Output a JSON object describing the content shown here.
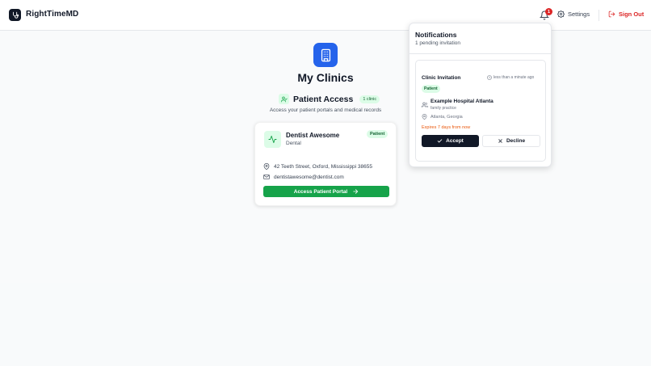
{
  "header": {
    "app_name": "RightTimeMD",
    "notification_count": "1",
    "settings_label": "Settings",
    "signout_label": "Sign Out"
  },
  "main": {
    "title": "My Clinics",
    "section": {
      "title": "Patient Access",
      "count_badge": "1 clinic",
      "subtitle": "Access your patient portals and medical records"
    },
    "clinic": {
      "name": "Dentist Awesome",
      "type": "Dental",
      "badge": "Patient",
      "address": "42 Teeth Street, Oxford, Mississippi 38655",
      "email": "dentistawesome@dentist.com",
      "button_label": "Access Patient Portal"
    }
  },
  "notifications": {
    "title": "Notifications",
    "subtitle": "1 pending invitation",
    "invitation": {
      "title": "Clinic Invitation",
      "time": "less than a minute ago",
      "badge": "Patient",
      "hospital_name": "Example Hospital Atlanta",
      "hospital_type": "family practice",
      "location": "Atlanta, Georgia",
      "expires": "Expires 7 days from now",
      "accept_label": "Accept",
      "decline_label": "Decline"
    }
  },
  "colors": {
    "primary_blue": "#2563eb",
    "success_green": "#16a34a",
    "danger_red": "#dc2626",
    "warning_orange": "#ea580c",
    "dark": "#111827"
  },
  "icons": {
    "logo": "stethoscope-icon",
    "bell": "bell-icon",
    "settings": "gear-icon",
    "signout": "sign-out-icon",
    "clinic_main": "building-icon",
    "section": "user-check-icon",
    "clinic": "activity-icon",
    "address": "map-pin-icon",
    "email": "mail-icon",
    "arrow": "arrow-right-icon",
    "clock": "clock-icon",
    "users": "users-icon",
    "check": "check-icon",
    "x": "x-icon"
  }
}
